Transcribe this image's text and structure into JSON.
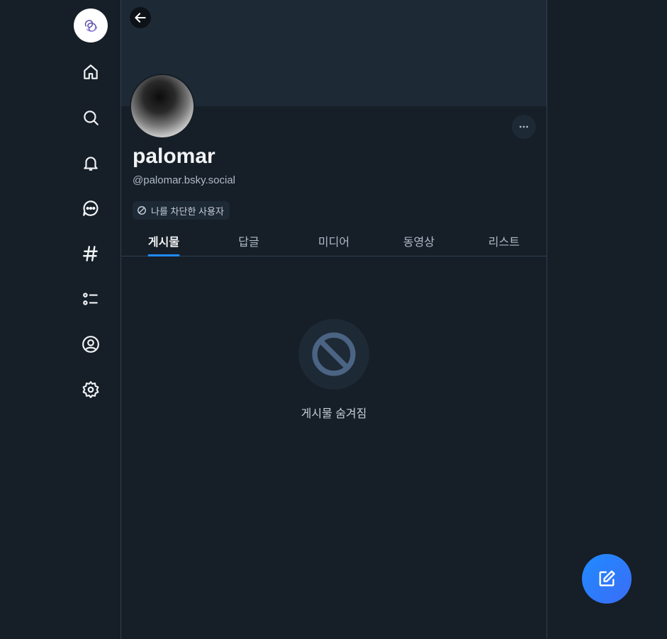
{
  "nav": {
    "items": [
      {
        "icon": "home-icon"
      },
      {
        "icon": "search-icon"
      },
      {
        "icon": "bell-icon"
      },
      {
        "icon": "chat-icon"
      },
      {
        "icon": "hashtag-icon"
      },
      {
        "icon": "list-icon"
      },
      {
        "icon": "profile-icon"
      },
      {
        "icon": "settings-icon"
      }
    ]
  },
  "profile": {
    "display_name": "palomar",
    "handle": "@palomar.bsky.social",
    "blocked_badge": "나를 차단한 사용자"
  },
  "tabs": [
    {
      "label": "게시물",
      "active": true
    },
    {
      "label": "답글",
      "active": false
    },
    {
      "label": "미디어",
      "active": false
    },
    {
      "label": "동영상",
      "active": false
    },
    {
      "label": "리스트",
      "active": false
    }
  ],
  "empty_state": {
    "message": "게시물 숨겨짐"
  },
  "colors": {
    "background": "#161e27",
    "accent": "#208bfe",
    "border": "#2e4052"
  }
}
